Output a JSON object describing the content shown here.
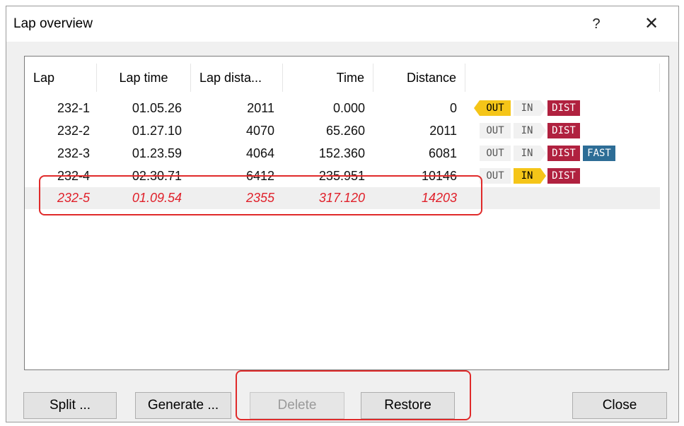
{
  "window": {
    "title": "Lap overview",
    "help_label": "?",
    "close_label": "✕"
  },
  "table": {
    "columns": [
      "Lap",
      "Lap time",
      "Lap dista...",
      "Time",
      "Distance"
    ],
    "rows": [
      {
        "lap": "232-1",
        "lap_time": "01.05.26",
        "lap_distance": "2011",
        "time": "0.000",
        "distance": "0",
        "tags": {
          "out": "OUT",
          "in": "IN",
          "dist": "DIST"
        }
      },
      {
        "lap": "232-2",
        "lap_time": "01.27.10",
        "lap_distance": "4070",
        "time": "65.260",
        "distance": "2011",
        "tags": {
          "out": "OUT",
          "in": "IN",
          "dist": "DIST"
        }
      },
      {
        "lap": "232-3",
        "lap_time": "01.23.59",
        "lap_distance": "4064",
        "time": "152.360",
        "distance": "6081",
        "tags": {
          "out": "OUT",
          "in": "IN",
          "dist": "DIST",
          "fast": "FAST"
        }
      },
      {
        "lap": "232-4",
        "lap_time": "02.30.71",
        "lap_distance": "6412",
        "time": "235.951",
        "distance": "10146",
        "tags": {
          "out": "OUT",
          "in": "IN",
          "dist": "DIST"
        }
      },
      {
        "lap": "232-5",
        "lap_time": "01.09.54",
        "lap_distance": "2355",
        "time": "317.120",
        "distance": "14203"
      }
    ]
  },
  "buttons": {
    "split": "Split ...",
    "generate": "Generate ...",
    "delete": "Delete",
    "restore": "Restore",
    "close": "Close"
  },
  "colors": {
    "highlight": "#e02a2a",
    "tag_active": "#f5c518",
    "tag_dist": "#b0213f",
    "tag_fast": "#2d6d96",
    "deleted_row_text": "#e0202a"
  }
}
